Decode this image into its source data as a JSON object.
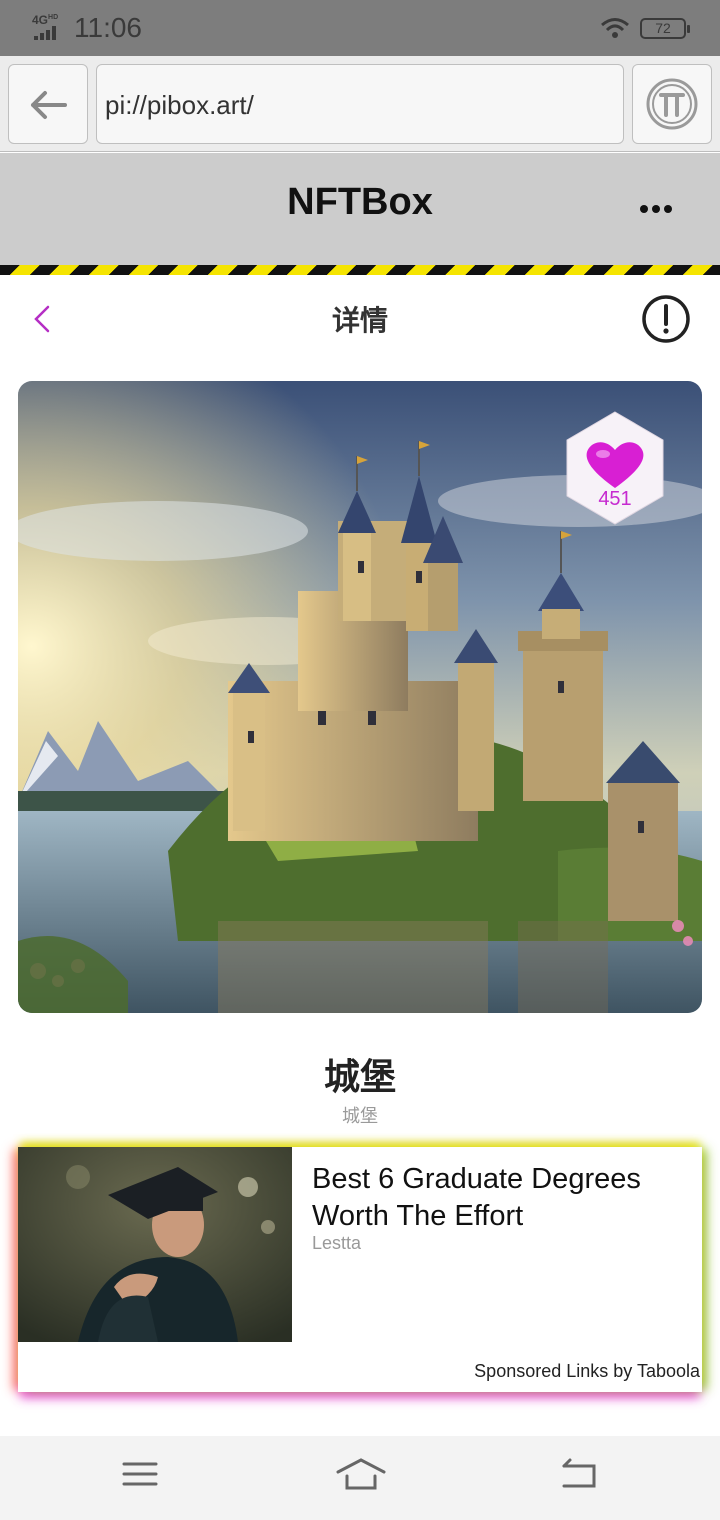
{
  "status_bar": {
    "network": "4G",
    "network_sup": "HD",
    "time": "11:06",
    "battery": "72"
  },
  "browser": {
    "url": "pi://pibox.art/"
  },
  "app": {
    "title": "NFTBox"
  },
  "detail": {
    "title": "详情"
  },
  "nft": {
    "likes": "451",
    "title": "城堡",
    "subtitle": "城堡"
  },
  "ad": {
    "headline": "Best 6 Graduate Degrees Worth The Effort",
    "source": "Lestta",
    "sponsor": "Sponsored Links by Taboola"
  },
  "colors": {
    "accent": "#b52ec4",
    "heart": "#d81fd3",
    "hazard_yellow": "#f5e400"
  },
  "icons": {
    "back": "arrow-left-icon",
    "pi": "pi-logo-icon",
    "more": "ellipsis-icon",
    "detail_back": "chevron-left-icon",
    "report": "alert-circle-icon",
    "like": "heart-icon",
    "menu": "menu-icon",
    "home": "home-icon",
    "return": "return-icon"
  }
}
